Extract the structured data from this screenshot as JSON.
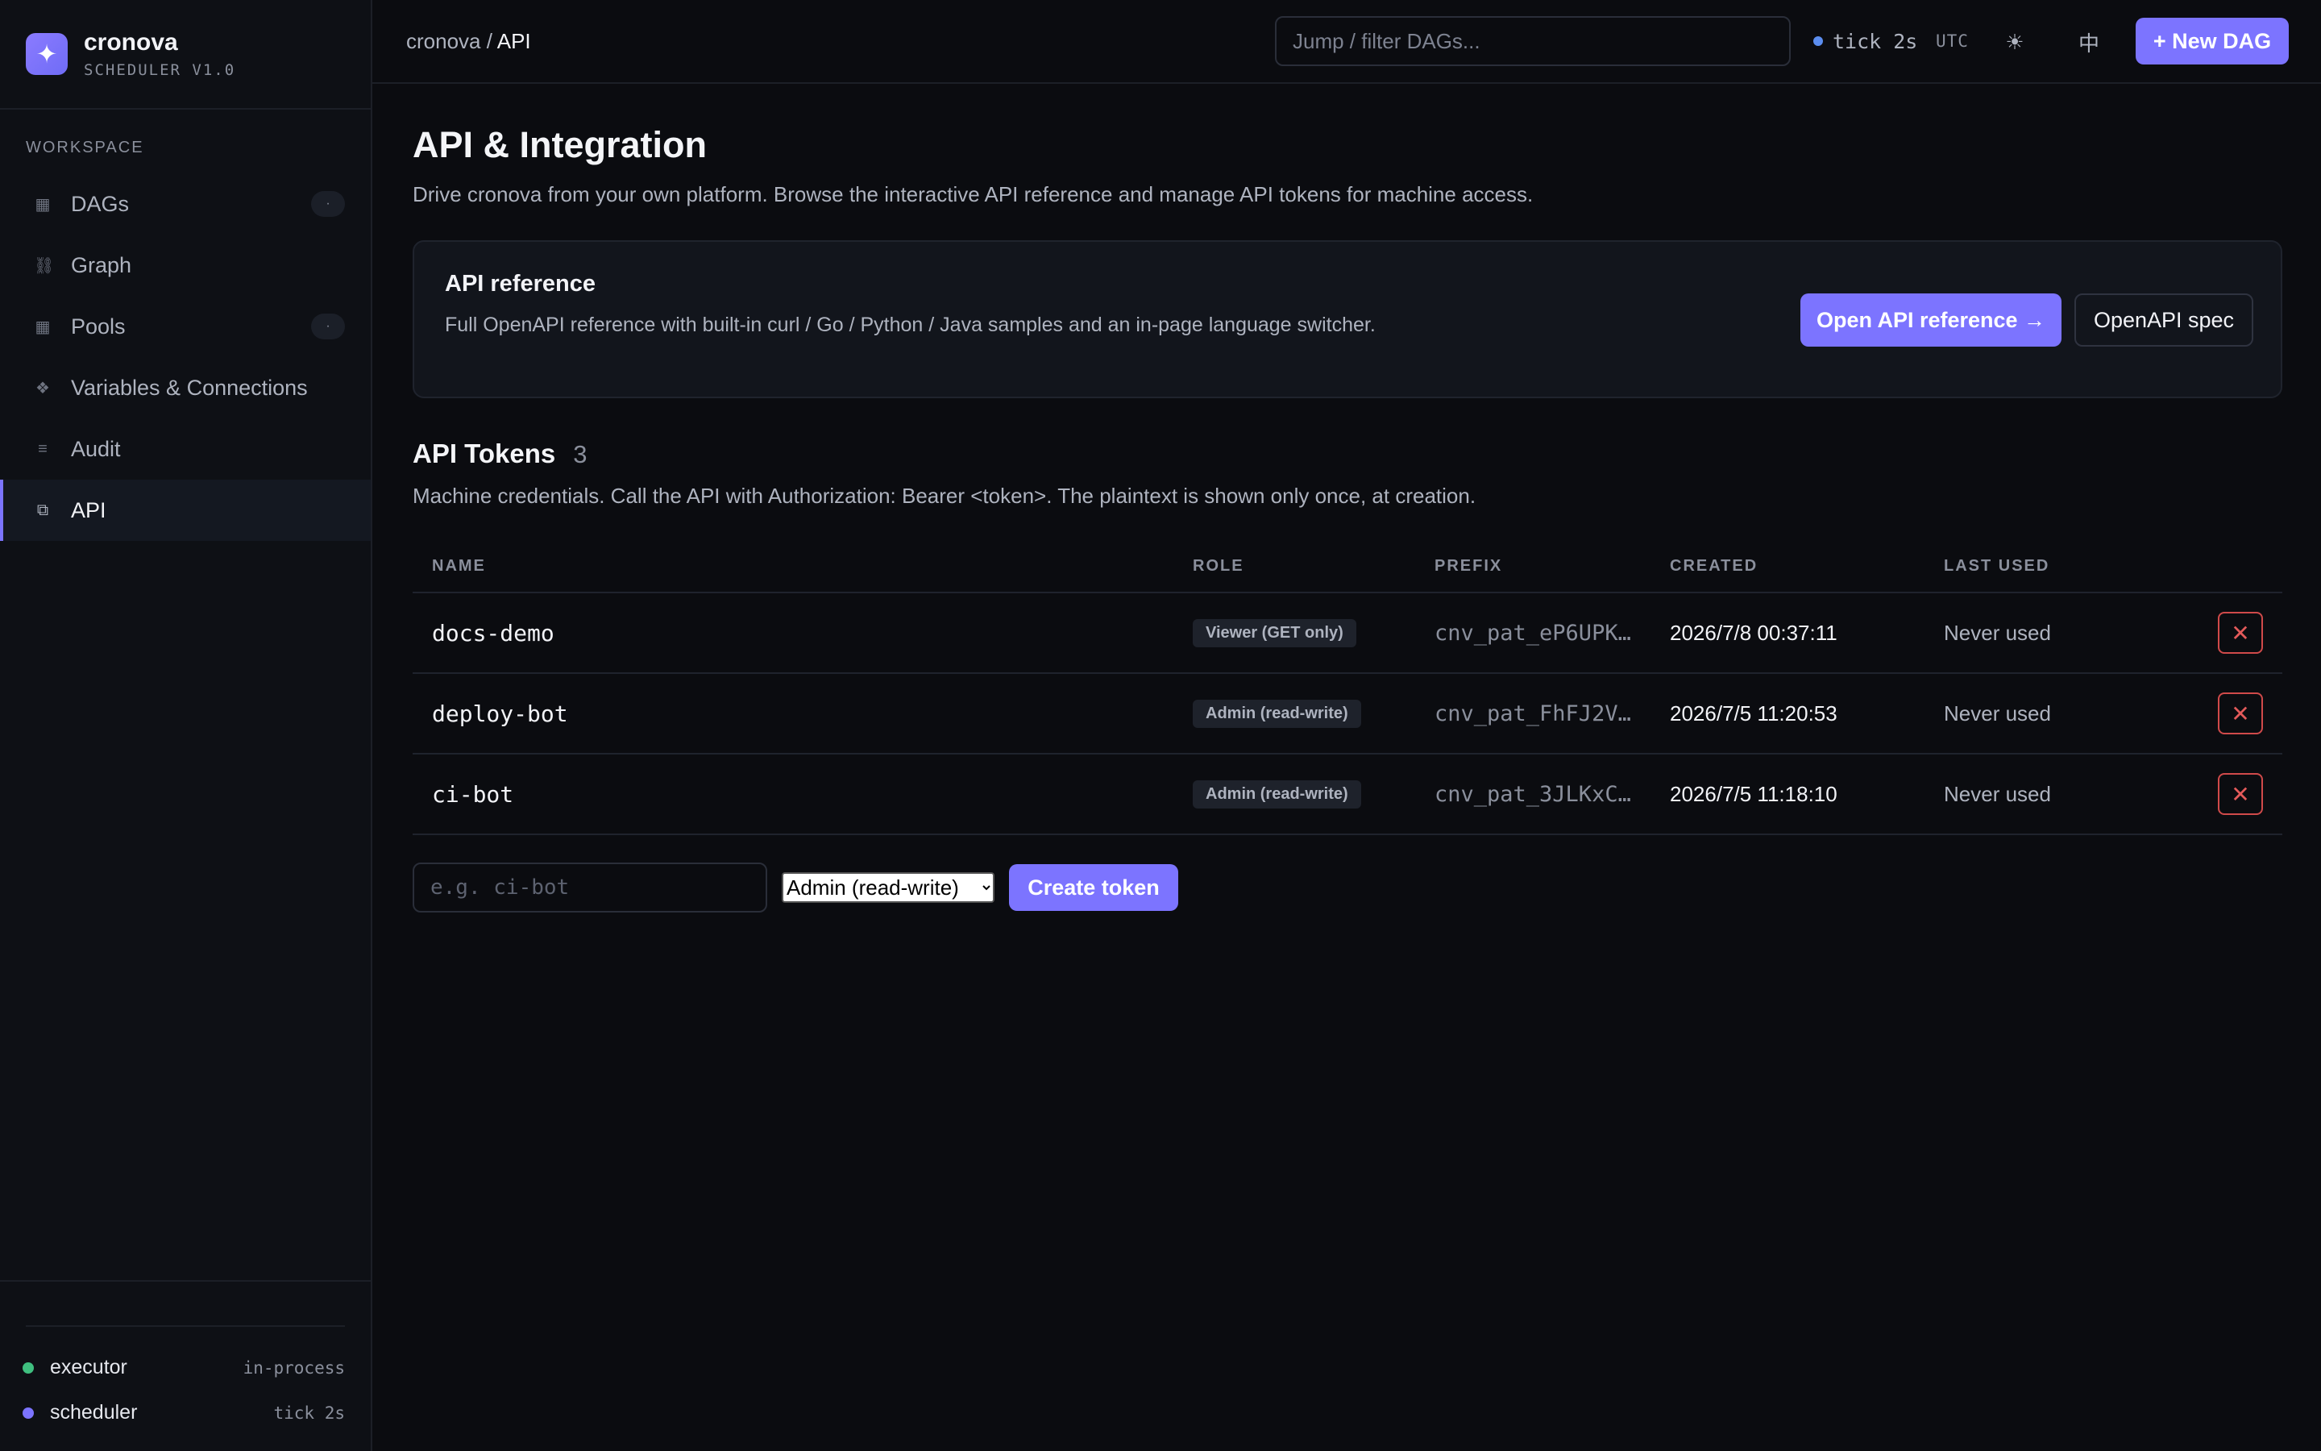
{
  "app": {
    "name": "cronova",
    "version": "SCHEDULER V1.0",
    "logo_glyph": "✦",
    "accent": "#7c74ff"
  },
  "sidebar": {
    "section": "WORKSPACE",
    "items": [
      {
        "label": "DAGs",
        "icon": "grid-icon",
        "glyph": "▦",
        "count": "·"
      },
      {
        "label": "Graph",
        "icon": "graph-icon",
        "glyph": "⛓"
      },
      {
        "label": "Pools",
        "icon": "pool-icon",
        "glyph": "▦",
        "count": "·"
      },
      {
        "label": "Variables & Connections",
        "icon": "variables-icon",
        "glyph": "❖"
      },
      {
        "label": "Audit",
        "icon": "audit-icon",
        "glyph": "≡"
      },
      {
        "label": "API",
        "icon": "api-icon",
        "glyph": "⧉",
        "active": true
      }
    ],
    "footer": {
      "executor": {
        "label": "executor",
        "value": "in-process",
        "color": "#3fbf7f"
      },
      "scheduler": {
        "label": "scheduler",
        "value": "tick 2s",
        "color": "#7c74ff"
      }
    }
  },
  "topbar": {
    "breadcrumb_root": "cronova",
    "breadcrumb_sep": " / ",
    "breadcrumb_current": "API",
    "search_placeholder": "Jump / filter DAGs...",
    "tick": "tick 2s",
    "timezone": "UTC",
    "theme_icon": "☀",
    "lang_label": "中",
    "new_dag_label": "+ New DAG"
  },
  "main": {
    "title": "API & Integration",
    "subtitle": "Drive cronova from your own platform. Browse the interactive API reference and manage API tokens for machine access.",
    "reference": {
      "title": "API reference",
      "description": "Full OpenAPI reference with built-in curl / Go / Python / Java samples and an in-page language switcher.",
      "open_label": "Open API reference →",
      "spec_label": "OpenAPI spec"
    },
    "tokens": {
      "title": "API Tokens",
      "count": "3",
      "subtitle": "Machine credentials. Call the API with Authorization: Bearer <token>. The plaintext is shown only once, at creation.",
      "columns": [
        "NAME",
        "ROLE",
        "PREFIX",
        "CREATED",
        "LAST USED"
      ],
      "rows": [
        {
          "name": "docs-demo",
          "role": "Viewer (GET only)",
          "prefix": "cnv_pat_eP6UPK…",
          "created": "2026/7/8 00:37:11",
          "last_used": "Never used"
        },
        {
          "name": "deploy-bot",
          "role": "Admin (read-write)",
          "prefix": "cnv_pat_FhFJ2V…",
          "created": "2026/7/5 11:20:53",
          "last_used": "Never used"
        },
        {
          "name": "ci-bot",
          "role": "Admin (read-write)",
          "prefix": "cnv_pat_3JLKxC…",
          "created": "2026/7/5 11:18:10",
          "last_used": "Never used"
        }
      ],
      "create": {
        "name_placeholder": "e.g. ci-bot",
        "role_selected": "Admin (read-write)",
        "submit_label": "Create token"
      }
    }
  }
}
